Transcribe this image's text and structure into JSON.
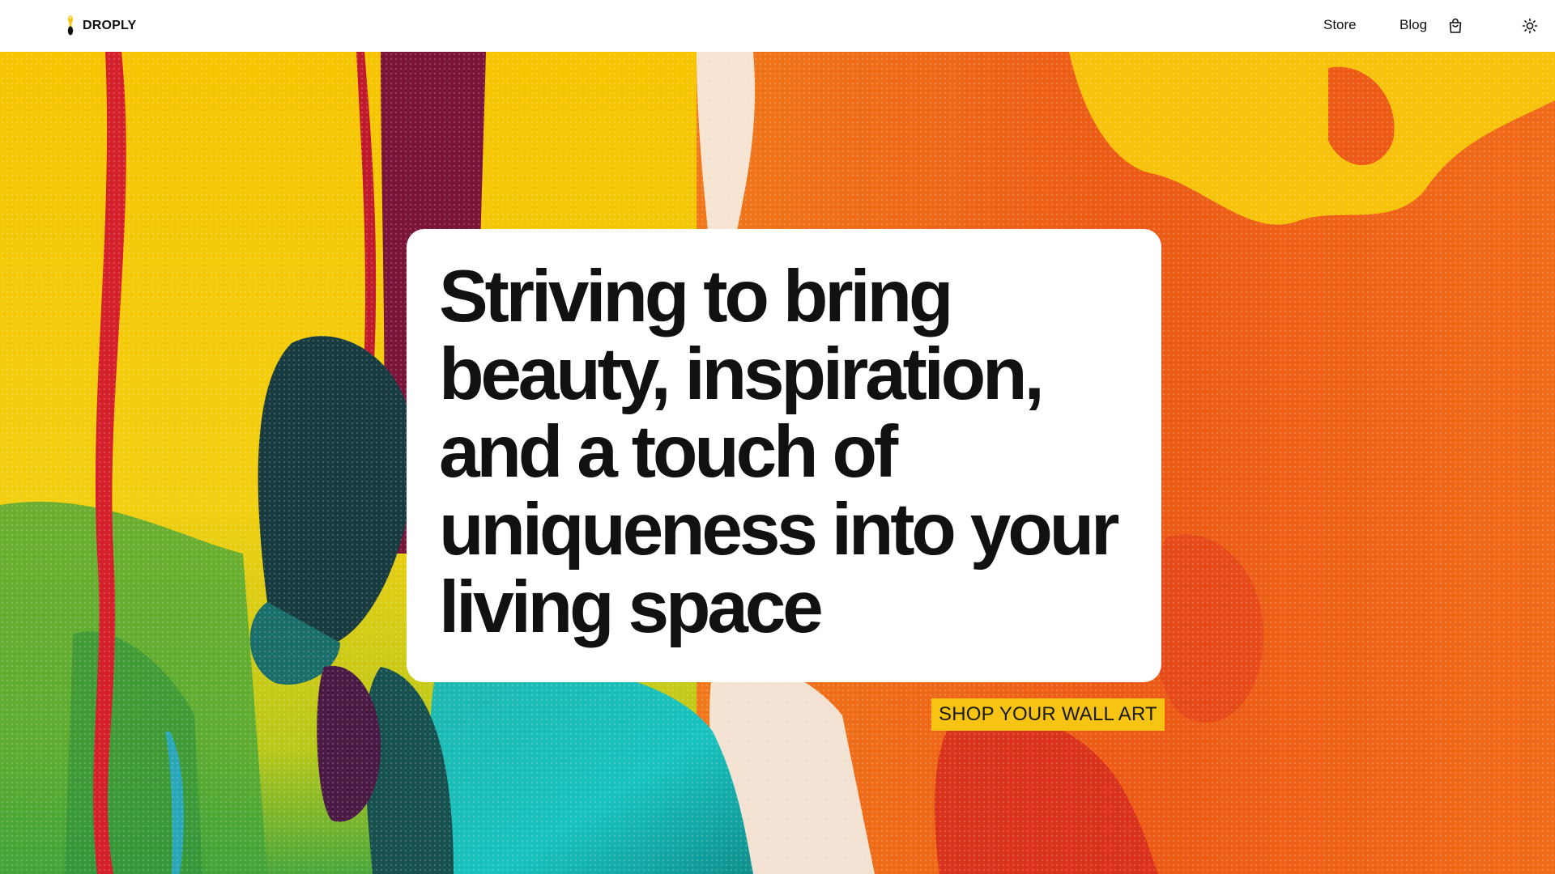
{
  "brand": {
    "name": "DROPLY",
    "logo_icon": "paint-drop-icon",
    "logo_colors": [
      "#f7c414",
      "#111111"
    ]
  },
  "nav": {
    "links": [
      {
        "label": "Store"
      },
      {
        "label": "Blog"
      }
    ],
    "icons": [
      "shopping-bag-icon",
      "sun-icon"
    ]
  },
  "hero": {
    "headline": "Striving to bring beauty, inspiration, and a touch of uniqueness into your living space",
    "cta_label": "SHOP YOUR WALL ART",
    "colors": {
      "cta_background": "#f7c414",
      "card_background": "#ffffff",
      "headline_text": "#111111"
    }
  }
}
